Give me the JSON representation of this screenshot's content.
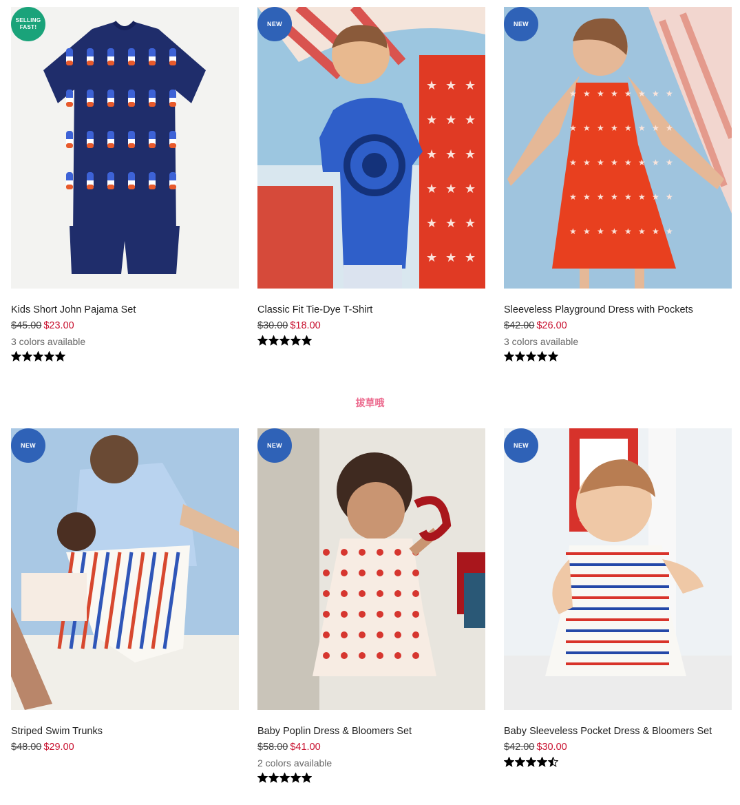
{
  "colors": {
    "badge_new": "#2f62b7",
    "badge_selling": "#1aa37a",
    "sale_price": "#c8102e"
  },
  "watermark": "拔草哦",
  "products": [
    {
      "title": "Kids Short John Pajama Set",
      "price_old": "$45.00",
      "price_new": "$23.00",
      "colors_text": "3 colors available",
      "badge": "SELLING FAST!",
      "badge_type": "selling",
      "rating": 5,
      "scene": "pajama"
    },
    {
      "title": "Classic Fit Tie-Dye T-Shirt",
      "price_old": "$30.00",
      "price_new": "$18.00",
      "colors_text": "",
      "badge": "NEW",
      "badge_type": "new",
      "rating": 5,
      "scene": "tiedye"
    },
    {
      "title": "Sleeveless Playground Dress with Pockets",
      "price_old": "$42.00",
      "price_new": "$26.00",
      "colors_text": "3 colors available",
      "badge": "NEW",
      "badge_type": "new",
      "rating": 5,
      "scene": "reddress"
    },
    {
      "title": "Striped Swim Trunks",
      "price_old": "$48.00",
      "price_new": "$29.00",
      "colors_text": "",
      "badge": "NEW",
      "badge_type": "new",
      "rating": 0,
      "scene": "trunks"
    },
    {
      "title": "Baby Poplin Dress & Bloomers Set",
      "price_old": "$58.00",
      "price_new": "$41.00",
      "colors_text": "2 colors available",
      "badge": "NEW",
      "badge_type": "new",
      "rating": 5,
      "scene": "cherry"
    },
    {
      "title": "Baby Sleeveless Pocket Dress & Bloomers Set",
      "price_old": "$42.00",
      "price_new": "$30.00",
      "colors_text": "",
      "badge": "NEW",
      "badge_type": "new",
      "rating": 4.5,
      "scene": "stripebaby"
    }
  ]
}
